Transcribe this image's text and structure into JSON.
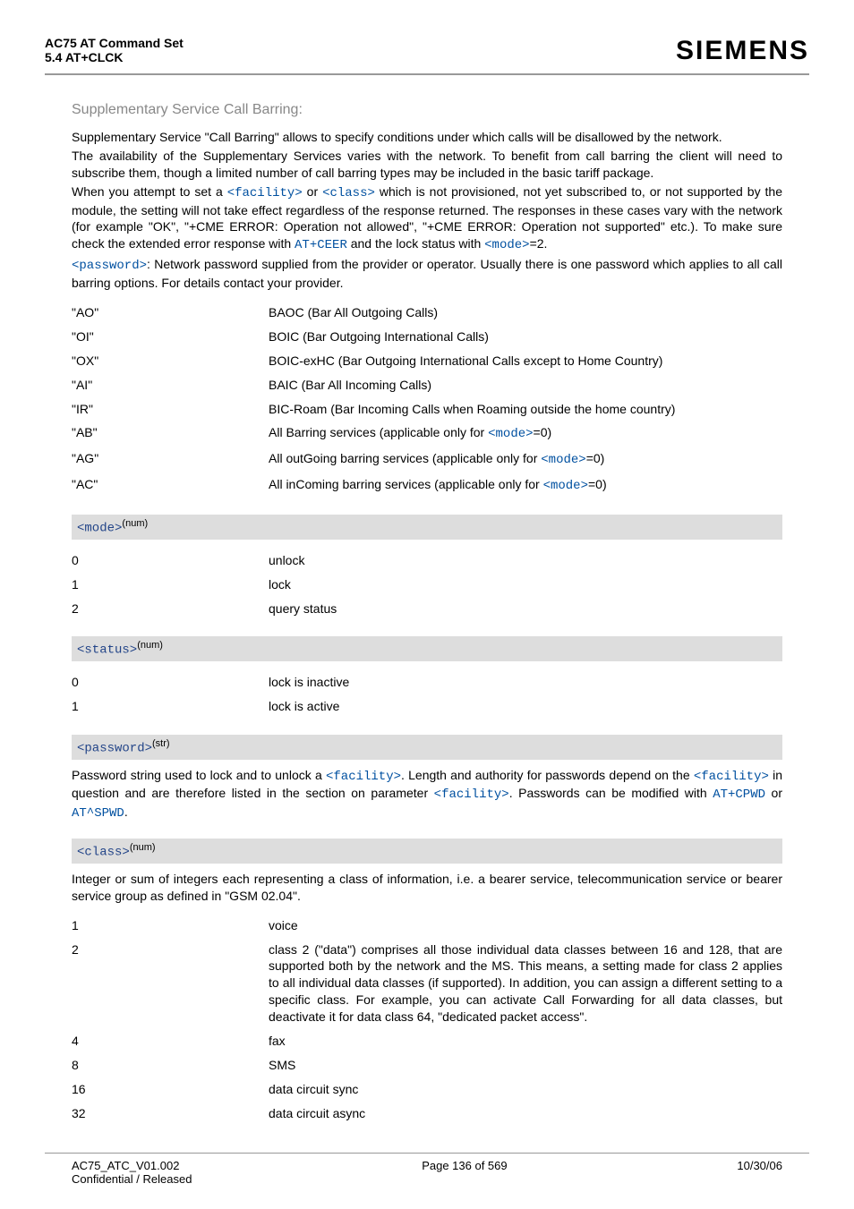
{
  "header": {
    "title": "AC75 AT Command Set",
    "subtitle": "5.4 AT+CLCK",
    "brand": "SIEMENS"
  },
  "section": {
    "title": "Supplementary Service Call Barring:",
    "p1": "Supplementary Service \"Call Barring\" allows to specify conditions under which calls will be disallowed by the network.",
    "p2": "The availability of the Supplementary Services varies with the network. To benefit from call barring the client will need to subscribe them, though a limited number of call barring types may be included in the basic tariff package.",
    "p3a": "When you attempt to set a ",
    "p3b": " or ",
    "p3c": " which is not provisioned, not yet subscribed to, or not supported by the module, the setting will not take effect regardless of the response returned. The responses in these cases vary with the network (for example \"OK\", \"+CME ERROR: Operation not allowed\", \"+CME ERROR: Operation not supported\" etc.). To make sure check the extended error response with ",
    "p3d": " and the lock status with ",
    "p3e": "=2.",
    "p4a": ": Network password supplied from the provider or operator. Usually there is one password which applies to all call barring options. For details contact your provider.",
    "links": {
      "facility": "<facility>",
      "class": "<class>",
      "atceer": "AT+CEER",
      "mode": "<mode>",
      "password": "<password>"
    }
  },
  "facilities": [
    {
      "k": "\"AO\"",
      "v": "BAOC (Bar All Outgoing Calls)"
    },
    {
      "k": "\"OI\"",
      "v": "BOIC (Bar Outgoing International Calls)"
    },
    {
      "k": "\"OX\"",
      "v": "BOIC-exHC (Bar Outgoing International Calls except to Home Country)"
    },
    {
      "k": "\"AI\"",
      "v": "BAIC (Bar All Incoming Calls)"
    },
    {
      "k": "\"IR\"",
      "v": "BIC-Roam (Bar Incoming Calls when Roaming outside the home country)"
    },
    {
      "k": "\"AB\"",
      "pre": "All Barring services (applicable only for ",
      "link": "<mode>",
      "post": "=0)"
    },
    {
      "k": "\"AG\"",
      "pre": "All outGoing barring services (applicable only for ",
      "link": "<mode>",
      "post": "=0)"
    },
    {
      "k": "\"AC\"",
      "pre": "All inComing barring services (applicable only for ",
      "link": "<mode>",
      "post": "=0)"
    }
  ],
  "mode_param": {
    "name": "<mode>",
    "sup": "(num)",
    "rows": [
      {
        "k": "0",
        "v": "unlock"
      },
      {
        "k": "1",
        "v": "lock"
      },
      {
        "k": "2",
        "v": "query status"
      }
    ]
  },
  "status_param": {
    "name": "<status>",
    "sup": "(num)",
    "rows": [
      {
        "k": "0",
        "v": "lock is inactive"
      },
      {
        "k": "1",
        "v": "lock is active"
      }
    ]
  },
  "password_param": {
    "name": "<password>",
    "sup": "(str)",
    "desc_a": "Password string used to lock and to unlock a ",
    "desc_b": ". Length and authority for passwords depend on the ",
    "desc_c": " in question and are therefore listed in the section on parameter ",
    "desc_d": ". Passwords can be modified with ",
    "desc_e": " or ",
    "desc_f": ".",
    "links": {
      "facility": "<facility>",
      "atcpwd": "AT+CPWD",
      "atspwd": "AT^SPWD"
    }
  },
  "class_param": {
    "name": "<class>",
    "sup": "(num)",
    "desc": "Integer or sum of integers each representing a class of information, i.e. a bearer service, telecommunication service or bearer service group as defined in \"GSM 02.04\".",
    "rows": [
      {
        "k": "1",
        "v": "voice"
      },
      {
        "k": "2",
        "v": "class 2 (\"data\") comprises all those individual data classes between 16 and 128, that are supported both by the network and the MS. This means, a setting made for class 2 applies to all individual data classes (if supported). In addition, you can assign a different setting to a specific class. For example, you can activate Call Forwarding for all data classes, but deactivate it for data class 64, \"dedicated packet access\"."
      },
      {
        "k": "4",
        "v": "fax"
      },
      {
        "k": "8",
        "v": "SMS"
      },
      {
        "k": "16",
        "v": "data circuit sync"
      },
      {
        "k": "32",
        "v": "data circuit async"
      }
    ]
  },
  "footer": {
    "left1": "AC75_ATC_V01.002",
    "left2": "Confidential / Released",
    "center": "Page 136 of 569",
    "right": "10/30/06"
  }
}
